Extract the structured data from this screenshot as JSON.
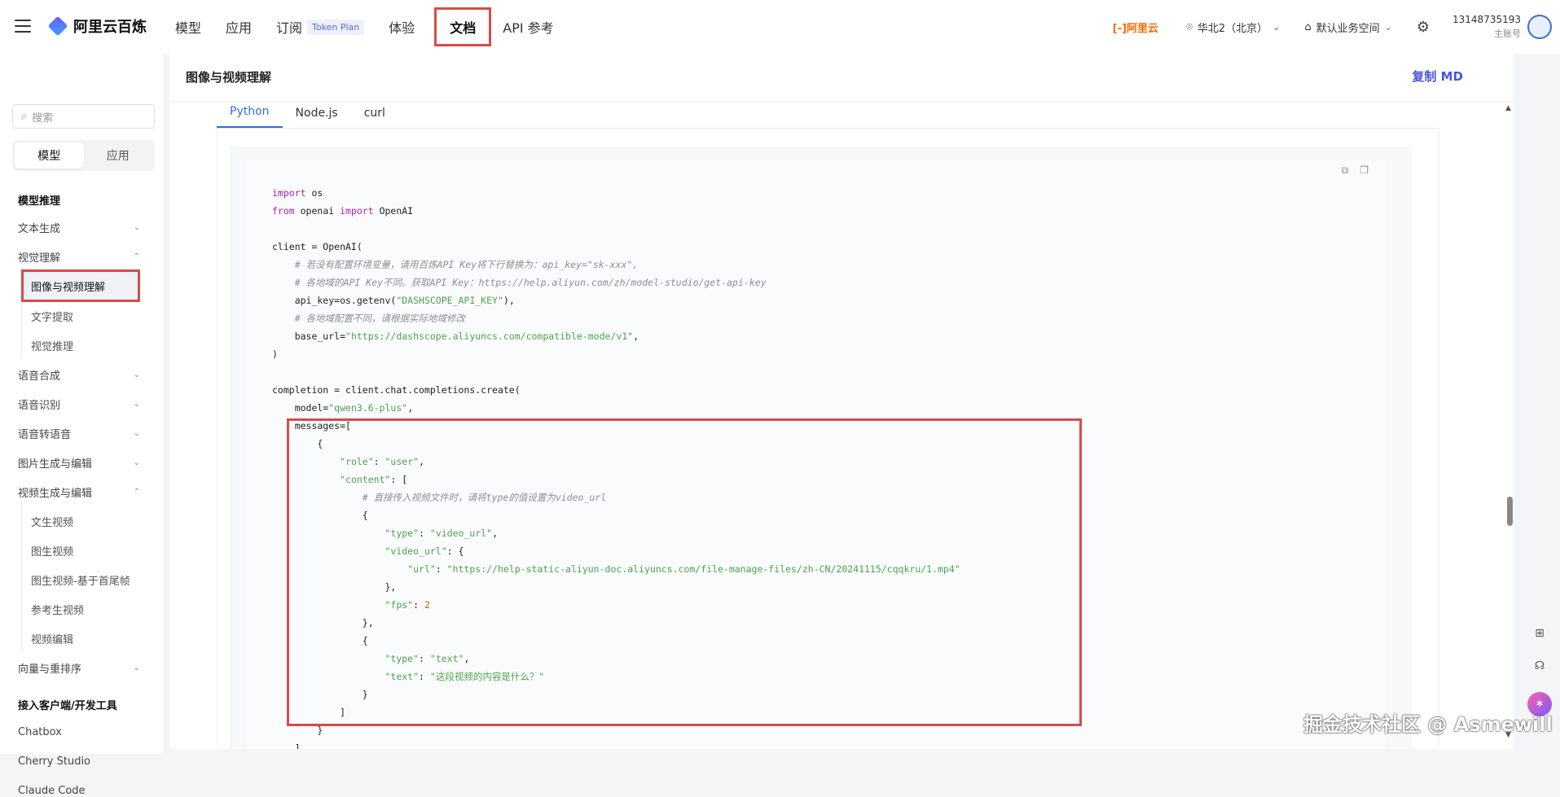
{
  "app": {
    "name": "阿里云百炼"
  },
  "nav": [
    {
      "label": "模型"
    },
    {
      "label": "应用"
    },
    {
      "label": "订阅",
      "badge": "Token Plan"
    },
    {
      "label": "体验"
    },
    {
      "label": "文档",
      "active": true
    },
    {
      "label": "API 参考"
    }
  ],
  "topright": {
    "brand": "[-]阿里云",
    "region": "华北2（北京）",
    "workspace": "默认业务空间",
    "account_id": "13148735193",
    "account_role": "主账号"
  },
  "sidebar": {
    "search_placeholder": "搜索",
    "segments": [
      "模型",
      "应用"
    ],
    "section_model": "模型推理",
    "items": {
      "text_gen": "文本生成",
      "vision": "视觉理解",
      "img_video": "图像与视频理解",
      "text_extract": "文字提取",
      "visual_reason": "视觉推理",
      "tts": "语音合成",
      "asr": "语音识别",
      "s2s": "语音转语音",
      "img_gen": "图片生成与编辑",
      "video_gen": "视频生成与编辑",
      "t2v": "文生视频",
      "i2v": "图生视频",
      "i2v_frames": "图生视频-基于首尾帧",
      "ref2v": "参考生视频",
      "video_edit": "视频编辑",
      "embed": "向量与重排序"
    },
    "section_tools": "接入客户端/开发工具",
    "tools": [
      "Chatbox",
      "Cherry Studio",
      "Claude Code"
    ]
  },
  "main": {
    "title": "图像与视频理解",
    "copy_md": "复制 MD",
    "tabs": [
      "Python",
      "Node.js",
      "curl"
    ]
  },
  "code_lines": [
    [
      [
        "kw",
        "import"
      ],
      [
        "p",
        " os"
      ]
    ],
    [
      [
        "kw",
        "from"
      ],
      [
        "p",
        " openai "
      ],
      [
        "kw",
        "import"
      ],
      [
        "p",
        " OpenAI"
      ]
    ],
    [
      [
        "p",
        ""
      ]
    ],
    [
      [
        "p",
        "client = OpenAI("
      ]
    ],
    [
      [
        "p",
        "    "
      ],
      [
        "cm",
        "# 若没有配置环境变量，请用百炼API Key将下行替换为：api_key=\"sk-xxx\","
      ]
    ],
    [
      [
        "p",
        "    "
      ],
      [
        "cm",
        "# 各地域的API Key不同。获取API Key：https://help.aliyun.com/zh/model-studio/get-api-key"
      ]
    ],
    [
      [
        "p",
        "    api_key=os.getenv("
      ],
      [
        "str",
        "\"DASHSCOPE_API_KEY\""
      ],
      [
        "p",
        "),"
      ]
    ],
    [
      [
        "p",
        "    "
      ],
      [
        "cm",
        "# 各地域配置不同，请根据实际地域修改"
      ]
    ],
    [
      [
        "p",
        "    base_url="
      ],
      [
        "str",
        "\"https://dashscope.aliyuncs.com/compatible-mode/v1\""
      ],
      [
        "p",
        ","
      ]
    ],
    [
      [
        "p",
        ")"
      ]
    ],
    [
      [
        "p",
        ""
      ]
    ],
    [
      [
        "p",
        "completion = client.chat.completions.create("
      ]
    ],
    [
      [
        "p",
        "    model="
      ],
      [
        "str",
        "\"qwen3.6-plus\""
      ],
      [
        "p",
        ","
      ]
    ],
    [
      [
        "p",
        "    messages=["
      ]
    ],
    [
      [
        "p",
        "        {"
      ]
    ],
    [
      [
        "p",
        "            "
      ],
      [
        "str",
        "\"role\""
      ],
      [
        "p",
        ": "
      ],
      [
        "str",
        "\"user\""
      ],
      [
        "p",
        ","
      ]
    ],
    [
      [
        "p",
        "            "
      ],
      [
        "str",
        "\"content\""
      ],
      [
        "p",
        ": ["
      ]
    ],
    [
      [
        "p",
        "                "
      ],
      [
        "cm",
        "# 直接传入视频文件时，请将type的值设置为video_url"
      ]
    ],
    [
      [
        "p",
        "                {"
      ]
    ],
    [
      [
        "p",
        "                    "
      ],
      [
        "str",
        "\"type\""
      ],
      [
        "p",
        ": "
      ],
      [
        "str",
        "\"video_url\""
      ],
      [
        "p",
        ","
      ]
    ],
    [
      [
        "p",
        "                    "
      ],
      [
        "str",
        "\"video_url\""
      ],
      [
        "p",
        ": {"
      ]
    ],
    [
      [
        "p",
        "                        "
      ],
      [
        "str",
        "\"url\""
      ],
      [
        "p",
        ": "
      ],
      [
        "str",
        "\"https://help-static-aliyun-doc.aliyuncs.com/file-manage-files/zh-CN/20241115/cqqkru/1.mp4\""
      ]
    ],
    [
      [
        "p",
        "                    },"
      ]
    ],
    [
      [
        "p",
        "                    "
      ],
      [
        "str",
        "\"fps\""
      ],
      [
        "p",
        ": "
      ],
      [
        "num",
        "2"
      ]
    ],
    [
      [
        "p",
        "                },"
      ]
    ],
    [
      [
        "p",
        "                {"
      ]
    ],
    [
      [
        "p",
        "                    "
      ],
      [
        "str",
        "\"type\""
      ],
      [
        "p",
        ": "
      ],
      [
        "str",
        "\"text\""
      ],
      [
        "p",
        ","
      ]
    ],
    [
      [
        "p",
        "                    "
      ],
      [
        "str",
        "\"text\""
      ],
      [
        "p",
        ": "
      ],
      [
        "str",
        "\"这段视频的内容是什么？\""
      ]
    ],
    [
      [
        "p",
        "                }"
      ]
    ],
    [
      [
        "p",
        "            ]"
      ]
    ],
    [
      [
        "p",
        "        }"
      ]
    ],
    [
      [
        "p",
        "    ]"
      ]
    ]
  ],
  "watermark": "掘金技术社区 @ Asmewill"
}
